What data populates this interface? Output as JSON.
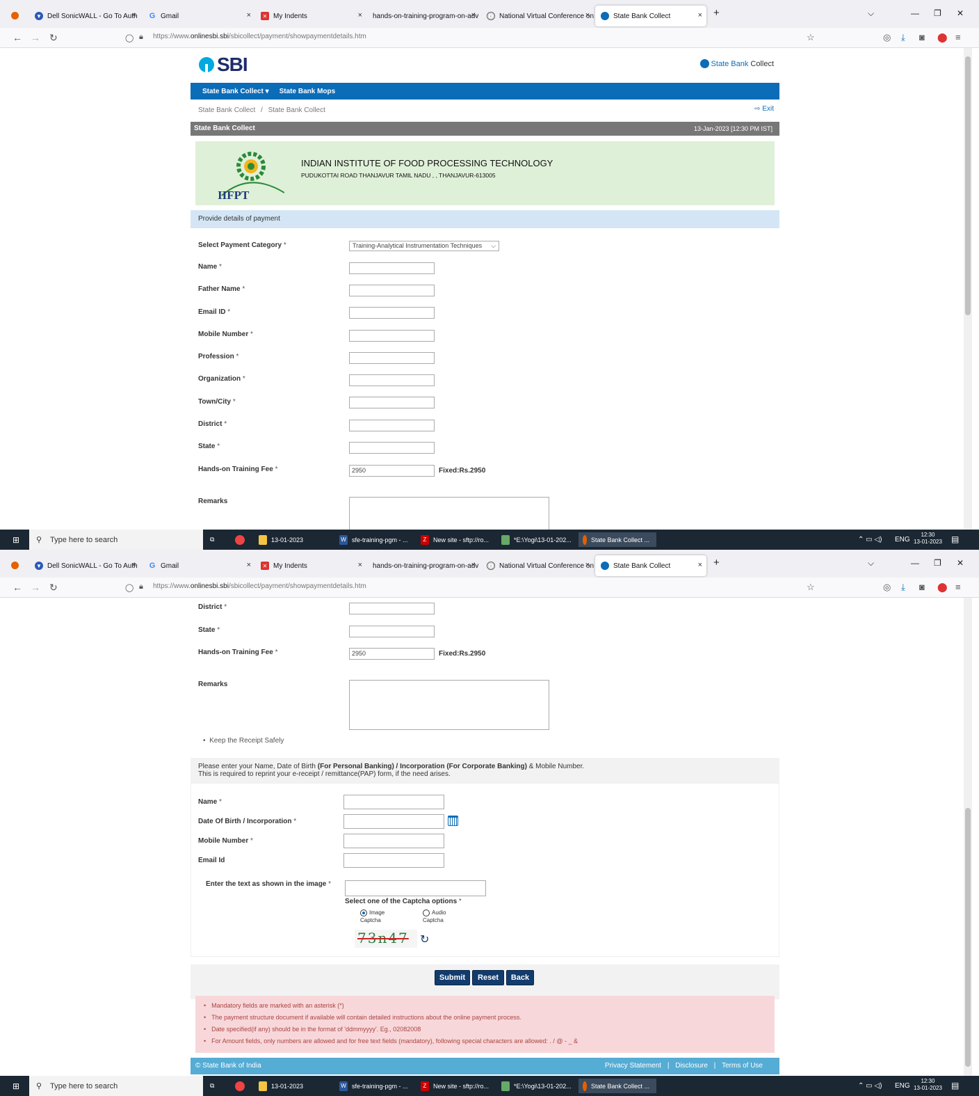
{
  "tabs": [
    {
      "label": "Dell SonicWALL - Go To Auth",
      "icon": "shield-icon"
    },
    {
      "label": "Gmail",
      "icon": "google-icon"
    },
    {
      "label": "My Indents",
      "icon": "indents-icon"
    },
    {
      "label": "hands-on-training-program-on-adv",
      "icon": "page-icon"
    },
    {
      "label": "National Virtual Conference on",
      "icon": "conference-icon"
    },
    {
      "label": "State Bank Collect",
      "icon": "sbi-icon"
    }
  ],
  "url": {
    "prefix": "https://www.",
    "domain": "onlinesbi.sbi",
    "path": "/sbicollect/payment/showpaymentdetails.htm"
  },
  "brand": {
    "logo": "SBI",
    "state_bank": "State Bank",
    "collect": "Collect"
  },
  "menu": {
    "collect": "State Bank Collect ▾",
    "mops": "State Bank Mops"
  },
  "breadcrumb": {
    "first": "State Bank Collect",
    "sep": "/",
    "second": "State Bank Collect",
    "exit": "Exit"
  },
  "titlebar": {
    "title": "State Bank Collect",
    "datetime": "13-Jan-2023 [12:30 PM IST]"
  },
  "institute": {
    "abbr": "IIFPT",
    "name": "INDIAN INSTITUTE OF FOOD PROCESSING TECHNOLOGY",
    "address": "PUDUKOTTAI ROAD THANJAVUR TAMIL NADU , , THANJAVUR-613005"
  },
  "provide": "Provide details of payment",
  "form": {
    "category_label": "Select Payment Category",
    "category_value": "Training-Analytical Instrumentation Techniques",
    "name": "Name",
    "father": "Father Name",
    "email": "Email ID",
    "mobile": "Mobile Number",
    "profession": "Profession",
    "organization": "Organization",
    "town": "Town/City",
    "district": "District",
    "state": "State",
    "fee_label": "Hands-on Training Fee",
    "fee_value": "2950",
    "fee_fixed": "Fixed:Rs.2950",
    "remarks": "Remarks",
    "req": "*"
  },
  "keep": "Keep the Receipt Safely",
  "info": {
    "pre": "Please enter your Name, Date of Birth",
    "bold": "(For Personal Banking) / Incorporation (For Corporate Banking)",
    "post": "& Mobile Number.",
    "line2": "This is required to reprint your e-receipt / remittance(PAP) form, if the need arises."
  },
  "reprint": {
    "name": "Name",
    "dob": "Date Of Birth / Incorporation",
    "mobile": "Mobile Number",
    "email": "Email Id"
  },
  "captcha": {
    "prompt": "Enter the text as shown in the image",
    "options_label": "Select one of the Captcha options",
    "image_opt": "Image",
    "audio_opt": "Audio",
    "captcha_word": "Captcha",
    "text": "73n47"
  },
  "buttons": {
    "submit": "Submit",
    "reset": "Reset",
    "back": "Back"
  },
  "notes": [
    "Mandatory fields are marked with an asterisk (*)",
    "The payment structure document if available will contain detailed instructions about the online payment process.",
    "Date specified(if any) should be in the format of 'ddmmyyyy'. Eg., 02082008",
    "For Amount fields, only numbers are allowed and for free text fields (mandatory), following special characters are allowed: . / @ - _ &"
  ],
  "footer": {
    "copyright": "© State Bank of India",
    "privacy": "Privacy Statement",
    "disclosure": "Disclosure",
    "terms": "Terms of Use",
    "sep": "|"
  },
  "taskbar": {
    "search": "Type here to search",
    "apps": [
      "13-01-2023",
      "sfe-training-pgm - ...",
      "New site - sftp://ro...",
      "*E:\\Yogi\\13-01-202...",
      "State Bank Collect ..."
    ],
    "lang": "ENG",
    "time": "12:30",
    "date": "13-01-2023"
  },
  "colors": {
    "sbi_blue": "#0b6cb8",
    "inst_green": "#dff0d8",
    "alert_red": "#f8d7da",
    "footer": "#55acd4",
    "button": "#123c6e"
  }
}
